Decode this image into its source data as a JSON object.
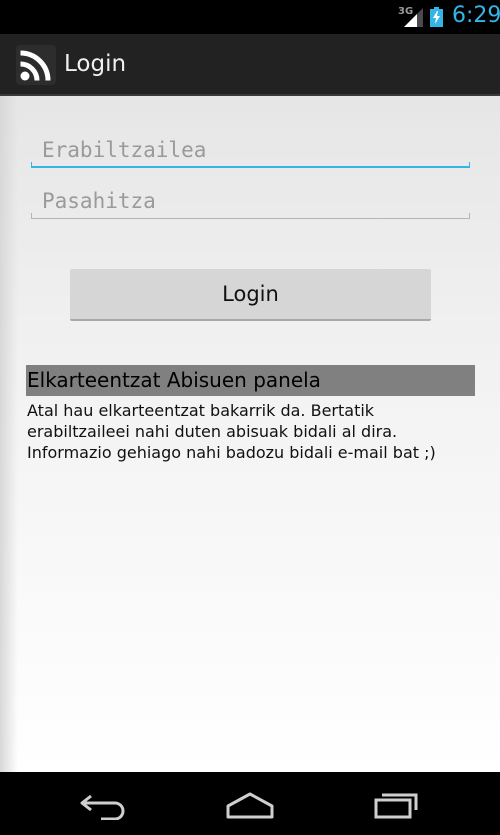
{
  "status_bar": {
    "network_label": "3G",
    "time": "6:29"
  },
  "action_bar": {
    "app_icon": "rss-icon",
    "title": "Login"
  },
  "form": {
    "username_placeholder": "Erabiltzailea",
    "username_value": "",
    "password_placeholder": "Pasahitza",
    "password_value": "",
    "login_label": "Login"
  },
  "panel": {
    "title": "Elkarteentzat Abisuen panela",
    "text": "Atal hau elkarteentzat bakarrik da. Bertatik erabiltzaileei nahi duten abisuak bidali al dira. Informazio gehiago nahi badozu bidali e-mail bat ;)"
  },
  "colors": {
    "accent": "#33b5e5",
    "action_bar": "#222222",
    "panel_title_bg": "#808080",
    "button_bg": "#d6d6d6"
  },
  "nav_bar": {
    "icons": [
      "back-icon",
      "home-icon",
      "recents-icon"
    ]
  }
}
